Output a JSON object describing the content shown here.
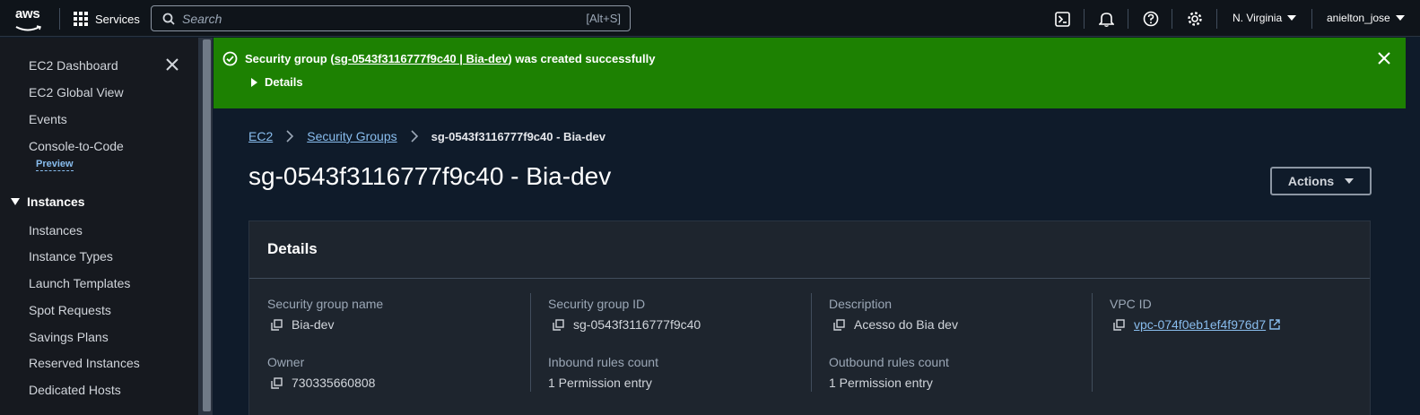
{
  "topnav": {
    "logo_text": "aws",
    "services_label": "Services",
    "search_placeholder": "Search",
    "search_shortcut": "[Alt+S]",
    "region": "N. Virginia",
    "user": "anielton_jose",
    "icons": [
      "cloudshell-icon",
      "notifications-icon",
      "help-icon",
      "settings-icon"
    ]
  },
  "sidebar": {
    "items": [
      {
        "label": "EC2 Dashboard"
      },
      {
        "label": "EC2 Global View"
      },
      {
        "label": "Events"
      },
      {
        "label": "Console-to-Code"
      }
    ],
    "preview_badge": "Preview",
    "section_title": "Instances",
    "section_items": [
      {
        "label": "Instances"
      },
      {
        "label": "Instance Types"
      },
      {
        "label": "Launch Templates"
      },
      {
        "label": "Spot Requests"
      },
      {
        "label": "Savings Plans"
      },
      {
        "label": "Reserved Instances"
      },
      {
        "label": "Dedicated Hosts"
      }
    ]
  },
  "flash": {
    "prefix": "Security group (",
    "link_text": "sg-0543f3116777f9c40 | Bia-dev",
    "suffix": ") was created successfully",
    "details_label": "Details",
    "color": "#1d8102"
  },
  "breadcrumb": {
    "items": [
      "EC2",
      "Security Groups"
    ],
    "current": "sg-0543f3116777f9c40 - Bia-dev"
  },
  "page": {
    "title": "sg-0543f3116777f9c40 - Bia-dev",
    "actions_label": "Actions"
  },
  "details": {
    "title": "Details",
    "fields": {
      "sg_name": {
        "label": "Security group name",
        "value": "Bia-dev"
      },
      "sg_id": {
        "label": "Security group ID",
        "value": "sg-0543f3116777f9c40"
      },
      "description": {
        "label": "Description",
        "value": "Acesso do Bia dev"
      },
      "vpc_id": {
        "label": "VPC ID",
        "value": "vpc-074f0eb1ef4f976d7"
      },
      "owner": {
        "label": "Owner",
        "value": "730335660808"
      },
      "inbound": {
        "label": "Inbound rules count",
        "value": "1 Permission entry"
      },
      "outbound": {
        "label": "Outbound rules count",
        "value": "1 Permission entry"
      }
    }
  },
  "colors": {
    "link": "#89bdee",
    "success": "#1d8102",
    "background": "#0f1b2a"
  }
}
